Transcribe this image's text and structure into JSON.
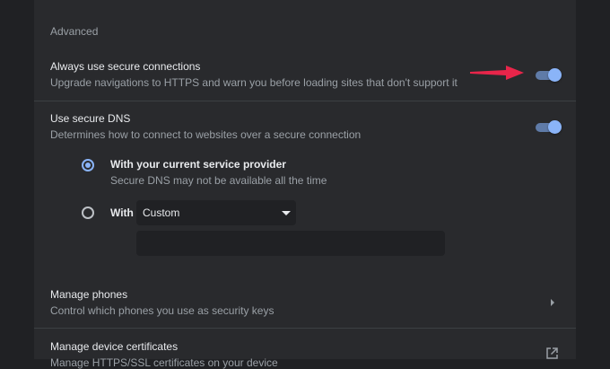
{
  "advanced": {
    "section_title": "Advanced",
    "secure_connections": {
      "title": "Always use secure connections",
      "description": "Upgrade navigations to HTTPS and warn you before loading sites that don't support it",
      "enabled": true
    },
    "secure_dns": {
      "title": "Use secure DNS",
      "description": "Determines how to connect to websites over a secure connection",
      "enabled": true,
      "options": [
        {
          "label": "With your current service provider",
          "sublabel": "Secure DNS may not be available all the time",
          "selected": true
        },
        {
          "label": "With",
          "selected": false,
          "provider_select": {
            "value": "Custom"
          },
          "custom_input": {
            "value": "",
            "placeholder": ""
          }
        }
      ]
    },
    "manage_phones": {
      "title": "Manage phones",
      "description": "Control which phones you use as security keys"
    },
    "manage_certificates": {
      "title": "Manage device certificates",
      "description": "Manage HTTPS/SSL certificates on your device"
    }
  },
  "annotation": {
    "arrow_color": "#e8254a"
  },
  "colors": {
    "accent": "#8ab4f8",
    "background": "#202124",
    "card": "#292a2d"
  },
  "icons": {
    "manage_phones": "chevron-right-icon",
    "manage_certificates": "open-external-icon",
    "annotation": "red-arrow-icon"
  }
}
